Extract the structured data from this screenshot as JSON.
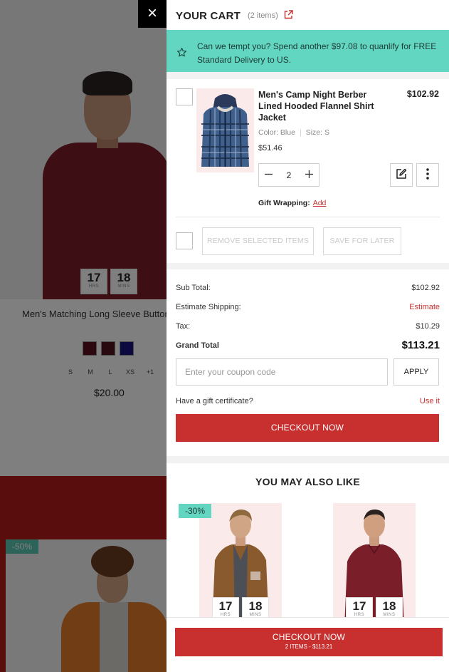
{
  "background": {
    "product_title": "Men's Matching Long Sleeve Button U",
    "timer": {
      "hours": "17",
      "hours_label": "HRS",
      "mins": "18",
      "mins_label": "MINS"
    },
    "sizes": [
      "S",
      "M",
      "L",
      "XS",
      "+1"
    ],
    "price": "$20.00",
    "swatch_colors": [
      "#5b0f1c",
      "#531221",
      "#18137e"
    ],
    "badge": "-50%"
  },
  "close_label": "×",
  "cart": {
    "title": "YOUR CART",
    "count": "(2 items)",
    "promo": "Can we tempt you? Spend another $97.08 to quanlify for FREE Standard Delivery to US.",
    "item": {
      "name": "Men's Camp Night Berber Lined Hooded Flannel Shirt Jacket",
      "price": "$102.92",
      "color_label": "Color: Blue",
      "size_label": "Size: S",
      "unit_price": "$51.46",
      "quantity": "2",
      "gift_label": "Gift Wrapping:",
      "gift_action": "Add"
    },
    "remove_selected": "REMOVE SELECTED ITEMS",
    "save_for_later": "SAVE FOR LATER"
  },
  "summary": {
    "subtotal_label": "Sub Total:",
    "subtotal": "$102.92",
    "shipping_label": "Estimate Shipping:",
    "shipping": "Estimate",
    "tax_label": "Tax:",
    "tax": "$10.29",
    "grand_label": "Grand Total",
    "grand": "$113.21",
    "coupon_placeholder": "Enter your coupon code",
    "apply": "APPLY",
    "gift_cert_label": "Have a gift certificate?",
    "gift_cert_action": "Use it",
    "checkout": "CHECKOUT NOW"
  },
  "recommendations": {
    "title": "YOU MAY ALSO LIKE",
    "badge": "-30%",
    "cards": [
      {
        "hours": "17",
        "hours_label": "HRS",
        "mins": "18",
        "mins_label": "MINS"
      },
      {
        "hours": "17",
        "hours_label": "HRS",
        "mins": "18",
        "mins_label": "MINS"
      }
    ]
  },
  "sticky_checkout": {
    "label": "CHECKOUT NOW",
    "sub": "2 ITEMS - $113.21"
  },
  "colors": {
    "accent_red": "#c8302f",
    "promo_teal": "#63d6c1"
  }
}
